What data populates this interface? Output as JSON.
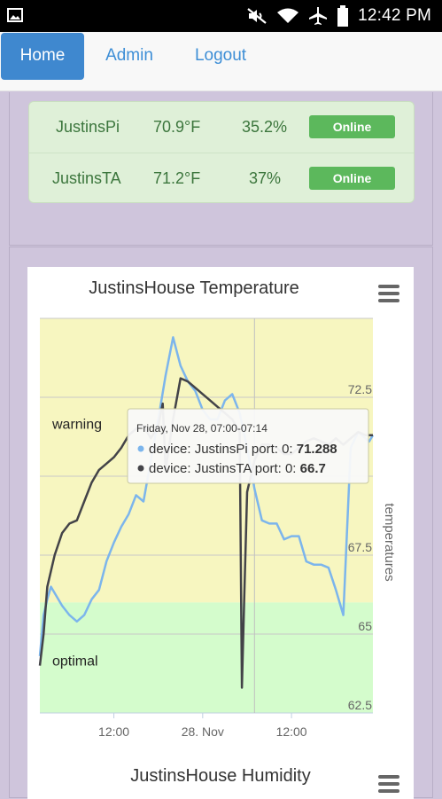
{
  "status_bar": {
    "time": "12:42 PM",
    "icons": [
      "image-icon",
      "mute-icon",
      "wifi-icon",
      "airplane-icon",
      "battery-icon"
    ]
  },
  "nav": {
    "home": "Home",
    "admin": "Admin",
    "logout": "Logout"
  },
  "devices": [
    {
      "name": "JustinsPi",
      "temperature": "70.9°F",
      "humidity": "35.2%",
      "status": "Online"
    },
    {
      "name": "JustinsTA",
      "temperature": "71.2°F",
      "humidity": "37%",
      "status": "Online"
    }
  ],
  "colors": {
    "nav_active": "#3f88cf",
    "link": "#3d8ed6",
    "online": "#5cb85c",
    "warning_band": "#f7f6c0",
    "optimal_band": "#d4fccc",
    "series_pi": "#7cb5ec",
    "series_ta": "#434348"
  },
  "chart_data": {
    "type": "line",
    "title": "JustinsHouse Temperature",
    "ylabel": "temperatures",
    "ylim": [
      62.5,
      75
    ],
    "y_ticks": [
      62.5,
      65,
      67.5,
      72.5
    ],
    "x_ticks": [
      "12:00",
      "28. Nov",
      "12:00"
    ],
    "x_tick_positions_hours": [
      12,
      24,
      36
    ],
    "xlim_hours": [
      2,
      47
    ],
    "plot_bands": [
      {
        "label": "warning",
        "from": 66,
        "to": 75
      },
      {
        "label": "optimal",
        "from": 62.5,
        "to": 66
      }
    ],
    "series": [
      {
        "name": "device: JustinsPi port: 0",
        "x_hours": [
          2,
          2.5,
          3,
          3.5,
          4,
          5,
          6,
          7,
          8,
          9,
          10,
          11,
          12,
          13,
          14,
          15,
          16,
          17,
          18,
          19,
          20,
          21,
          22,
          23,
          24,
          25,
          26,
          27,
          28,
          29,
          30,
          31,
          32,
          33,
          34,
          35,
          36,
          37,
          38,
          39,
          40,
          41,
          42,
          43,
          44,
          45,
          46,
          46.5,
          47
        ],
        "values": [
          64.3,
          65.6,
          66.1,
          66.5,
          66.3,
          65.9,
          65.6,
          65.4,
          65.6,
          66.1,
          66.4,
          67.3,
          67.9,
          68.4,
          68.8,
          69.4,
          69.2,
          70.5,
          71.8,
          73.2,
          74.4,
          73.5,
          73.0,
          72.7,
          72.1,
          71.8,
          71.8,
          72.4,
          72.6,
          72.0,
          70.9,
          69.6,
          68.6,
          68.5,
          68.5,
          68.0,
          68.1,
          68.1,
          67.3,
          67.2,
          67.2,
          67.1,
          66.4,
          65.6,
          70.9,
          71.4,
          71.2,
          71.1,
          71.3
        ]
      },
      {
        "name": "device: JustinsTA port: 0",
        "x_hours": [
          2,
          2.5,
          3,
          4,
          5,
          6,
          7,
          8,
          9,
          10,
          11,
          12,
          13,
          14,
          15,
          16,
          17,
          18,
          18.6,
          19,
          20,
          21,
          22,
          23,
          24,
          25,
          26,
          27,
          28,
          29,
          29.3,
          29.6,
          30,
          31,
          32,
          33,
          34,
          35,
          36,
          37,
          38,
          39,
          40,
          41,
          42,
          43,
          44,
          45,
          46,
          47
        ],
        "values": [
          64.0,
          65.0,
          66.5,
          67.5,
          68.2,
          68.5,
          68.6,
          69.2,
          69.8,
          70.2,
          70.4,
          70.6,
          70.9,
          71.3,
          71.5,
          71.6,
          71.2,
          71.6,
          72.3,
          70.2,
          71.8,
          73.1,
          73.0,
          72.8,
          72.6,
          72.4,
          72.2,
          72.0,
          71.8,
          71.4,
          63.3,
          66.0,
          69.5,
          70.5,
          71.0,
          71.0,
          70.9,
          70.7,
          70.7,
          70.9,
          71.1,
          71.2,
          71.1,
          71.0,
          71.2,
          71.0,
          71.2,
          71.4,
          71.3,
          71.3
        ]
      }
    ],
    "tooltip": {
      "header": "Friday, Nov 28, 07:00-07:14",
      "rows": [
        {
          "series": "device: JustinsPi port: 0: ",
          "value": "71.288"
        },
        {
          "series": "device: JustinsTA port: 0: ",
          "value": "66.7"
        }
      ]
    },
    "crosshair_hour": 31
  },
  "chart2": {
    "title": "JustinsHouse Humidity"
  }
}
